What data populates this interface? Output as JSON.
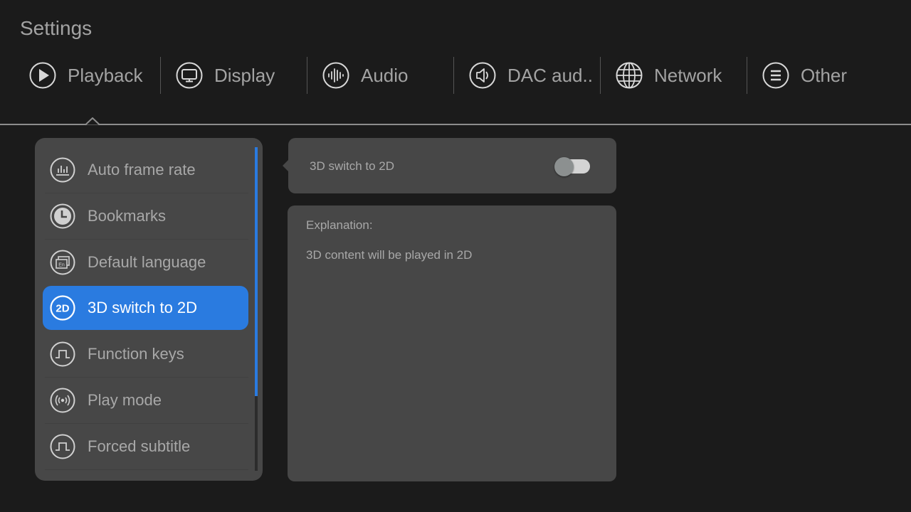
{
  "header": {
    "title": "Settings"
  },
  "tabs": [
    {
      "label": "Playback",
      "icon": "play-circle-icon",
      "selected": true
    },
    {
      "label": "Display",
      "icon": "monitor-icon",
      "selected": false
    },
    {
      "label": "Audio",
      "icon": "audio-waveform-icon",
      "selected": false
    },
    {
      "label": "DAC aud..",
      "icon": "speaker-icon",
      "selected": false
    },
    {
      "label": "Network",
      "icon": "globe-icon",
      "selected": false
    },
    {
      "label": "Other",
      "icon": "menu-lines-icon",
      "selected": false
    }
  ],
  "menu": {
    "items": [
      {
        "label": "Auto frame rate",
        "icon": "bar-chart-icon",
        "selected": false
      },
      {
        "label": "Bookmarks",
        "icon": "clock-icon",
        "selected": false
      },
      {
        "label": "Default language",
        "icon": "language-en-icon",
        "selected": false
      },
      {
        "label": "3D switch to 2D",
        "icon": "2d-icon",
        "selected": true
      },
      {
        "label": "Function keys",
        "icon": "pulse-wave-icon",
        "selected": false
      },
      {
        "label": "Play mode",
        "icon": "broadcast-icon",
        "selected": false
      },
      {
        "label": "Forced subtitle",
        "icon": "pulse-wave-icon",
        "selected": false
      }
    ],
    "scroll": {
      "thumb_fraction": 0.77,
      "position_fraction": 0.0
    }
  },
  "detail": {
    "toggle_label": "3D switch to 2D",
    "toggle_on": false,
    "explanation_heading": "Explanation:",
    "explanation_text": "3D content will be played in 2D"
  },
  "colors": {
    "accent": "#2a7be0",
    "background": "#1b1b1b",
    "panel": "#474747"
  }
}
